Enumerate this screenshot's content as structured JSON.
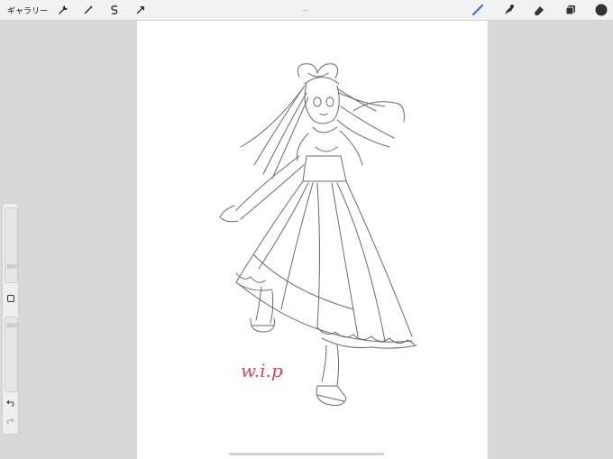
{
  "toolbar": {
    "gallery_label": "ギャラリー",
    "left_icons": [
      "wrench-icon",
      "magic-wand-icon",
      "selection-s-icon",
      "transform-arrow-icon"
    ],
    "right_icons": [
      "brush-icon",
      "smudge-icon",
      "eraser-icon",
      "layers-icon",
      "color-circle-icon"
    ],
    "accent_color": "#2f6fe0",
    "active_color": "#333333"
  },
  "sidebar": {
    "modify_button_icon": "square-modify-icon",
    "undo_icon": "undo-arrow-icon",
    "redo_icon": "redo-arrow-icon"
  },
  "canvas": {
    "annotation_text": "w.i.p",
    "annotation_color": "#d04a5a",
    "background": "#ffffff"
  }
}
